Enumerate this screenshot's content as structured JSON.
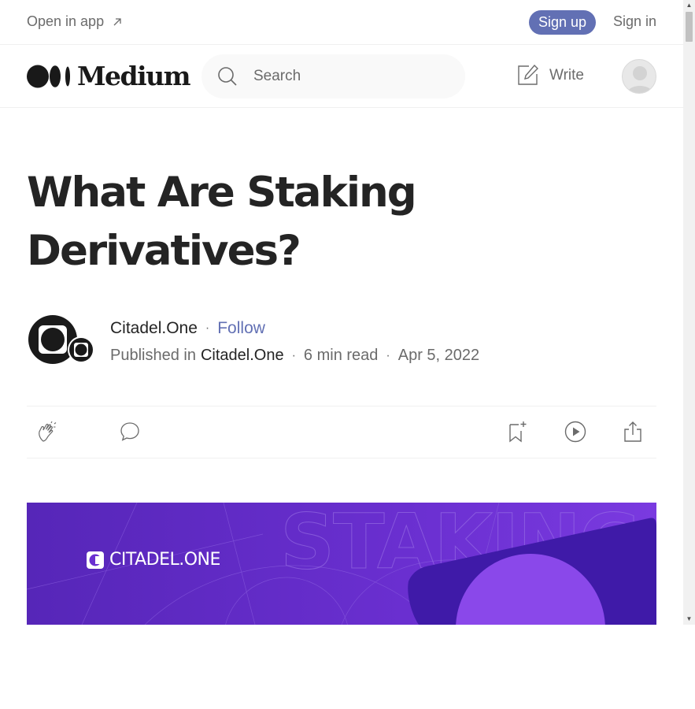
{
  "topbar": {
    "open_in_app": "Open in app",
    "sign_up": "Sign up",
    "sign_in": "Sign in"
  },
  "header": {
    "logo_text": "Medium",
    "search_placeholder": "Search",
    "write_label": "Write"
  },
  "article": {
    "title": "What Are Staking Derivatives?",
    "author": "Citadel.One",
    "follow_label": "Follow",
    "published_in_prefix": "Published in",
    "publication": "Citadel.One",
    "read_time": "6 min read",
    "date": "Apr 5, 2022",
    "separator": "·"
  },
  "hero_image": {
    "brand_text": "CITADEL.ONE",
    "watermark_text": "STAKING",
    "colors": {
      "base": "#5b2bbf",
      "accent": "#7a3ae0",
      "dark": "#3d1aa0"
    }
  },
  "icons": {
    "open_in_app": "arrow-up-right-icon",
    "search": "search-icon",
    "write": "edit-icon",
    "clap": "clap-icon",
    "comment": "comment-icon",
    "bookmark": "bookmark-add-icon",
    "listen": "play-icon",
    "share": "share-icon"
  },
  "colors": {
    "accent": "#6270b4",
    "text": "#242424",
    "muted": "#6b6b6b"
  }
}
